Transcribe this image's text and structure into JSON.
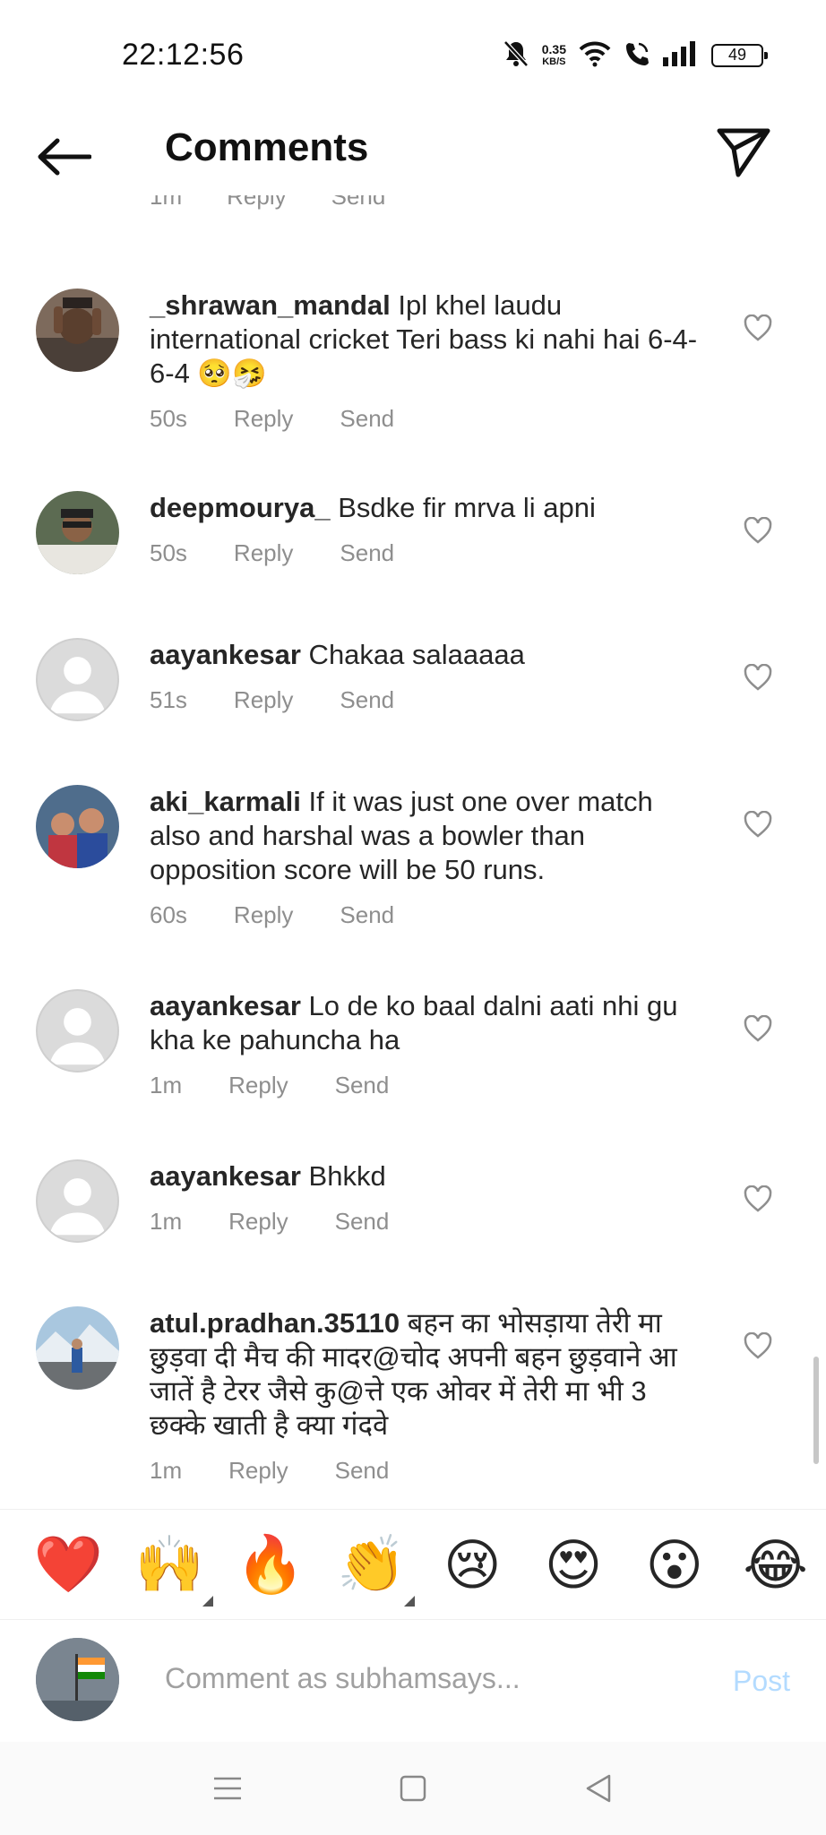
{
  "status": {
    "time": "22:12:56",
    "net_speed_value": "0.35",
    "net_speed_unit": "KB/S",
    "battery": "49"
  },
  "header": {
    "title": "Comments"
  },
  "previous_row": {
    "time": "1m",
    "reply": "Reply",
    "send": "Send"
  },
  "comments": [
    {
      "username": "_shrawan_mandal",
      "text": " Ipl khel laudu international cricket Teri bass ki nahi hai 6-4-6-4 🥺🤧",
      "time": "50s",
      "reply": "Reply",
      "send": "Send"
    },
    {
      "username": "deepmourya_",
      "text": " Bsdke fir mrva li apni",
      "time": "50s",
      "reply": "Reply",
      "send": "Send"
    },
    {
      "username": "aayankesar",
      "text": " Chakaa salaaaaa",
      "time": "51s",
      "reply": "Reply",
      "send": "Send"
    },
    {
      "username": "aki_karmali",
      "text": " If it was just one over match also and harshal was a bowler than opposition score will be 50 runs.",
      "time": "60s",
      "reply": "Reply",
      "send": "Send"
    },
    {
      "username": "aayankesar",
      "text": " Lo de ko baal dalni aati nhi gu kha ke pahuncha ha",
      "time": "1m",
      "reply": "Reply",
      "send": "Send"
    },
    {
      "username": "aayankesar",
      "text": " Bhkkd",
      "time": "1m",
      "reply": "Reply",
      "send": "Send"
    },
    {
      "username": "atul.pradhan.35110",
      "text": " बहन का भोसड़ाया तेरी मा छुड़वा दी मैच की मादर@चोद अपनी बहन छुड़वाने आ जातें है टेरर जैसे कु@त्ते एक ओवर में तेरी मा भी 3 छक्के खाती है क्या गंदवे",
      "time": "1m",
      "reply": "Reply",
      "send": "Send"
    }
  ],
  "emoji_bar": [
    "❤️",
    "🙌",
    "🔥",
    "👏",
    "😢",
    "😍",
    "😮",
    "😂"
  ],
  "composer": {
    "placeholder": "Comment as subhamsays...",
    "post_label": "Post"
  },
  "colors": {
    "meta_gray": "#8e8e8e",
    "post_disabled": "#b3dbff",
    "text": "#262626"
  }
}
